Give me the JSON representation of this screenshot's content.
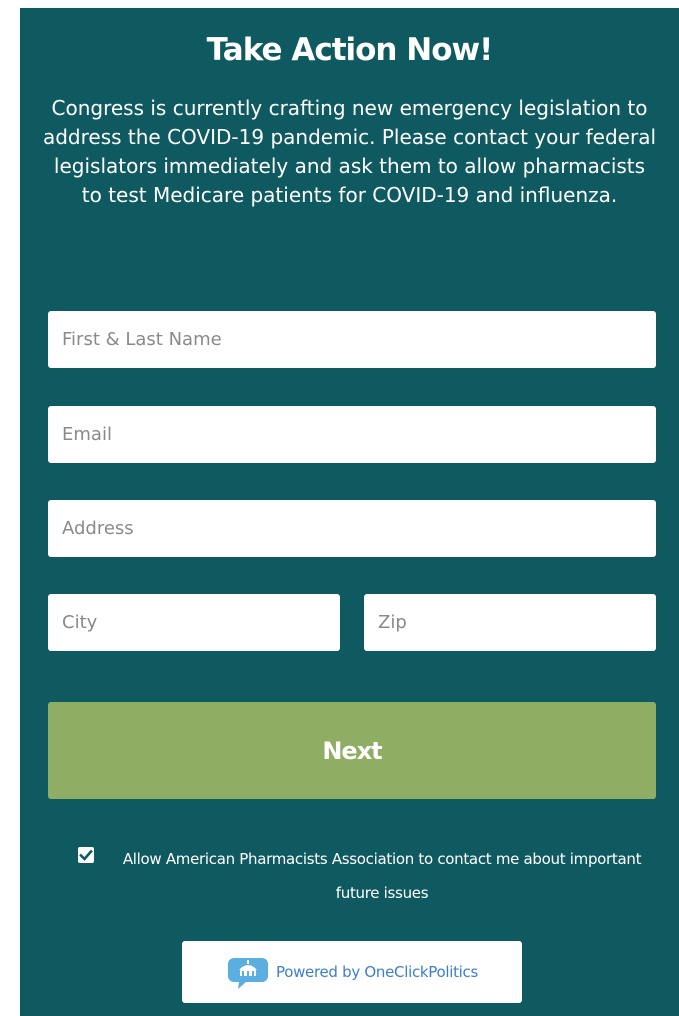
{
  "header": {
    "title": "Take Action Now!",
    "intro": "Congress is currently crafting new emergency legislation to address the COVID-19 pandemic. Please contact your federal legislators immediately and ask them to allow pharmacists to test Medicare patients for COVID-19 and influenza."
  },
  "form": {
    "name_placeholder": "First & Last Name",
    "email_placeholder": "Email",
    "address_placeholder": "Address",
    "city_placeholder": "City",
    "zip_placeholder": "Zip",
    "next_label": "Next"
  },
  "consent": {
    "checked": true,
    "label": "Allow American Pharmacists Association to contact me about important future issues"
  },
  "footer": {
    "powered_by": "Powered by OneClickPolitics",
    "logo_icon": "oneclickpolitics-logo-icon"
  },
  "colors": {
    "panel_background": "#0f5a60",
    "next_button": "#8fae63",
    "powered_text": "#3b7fd0"
  }
}
